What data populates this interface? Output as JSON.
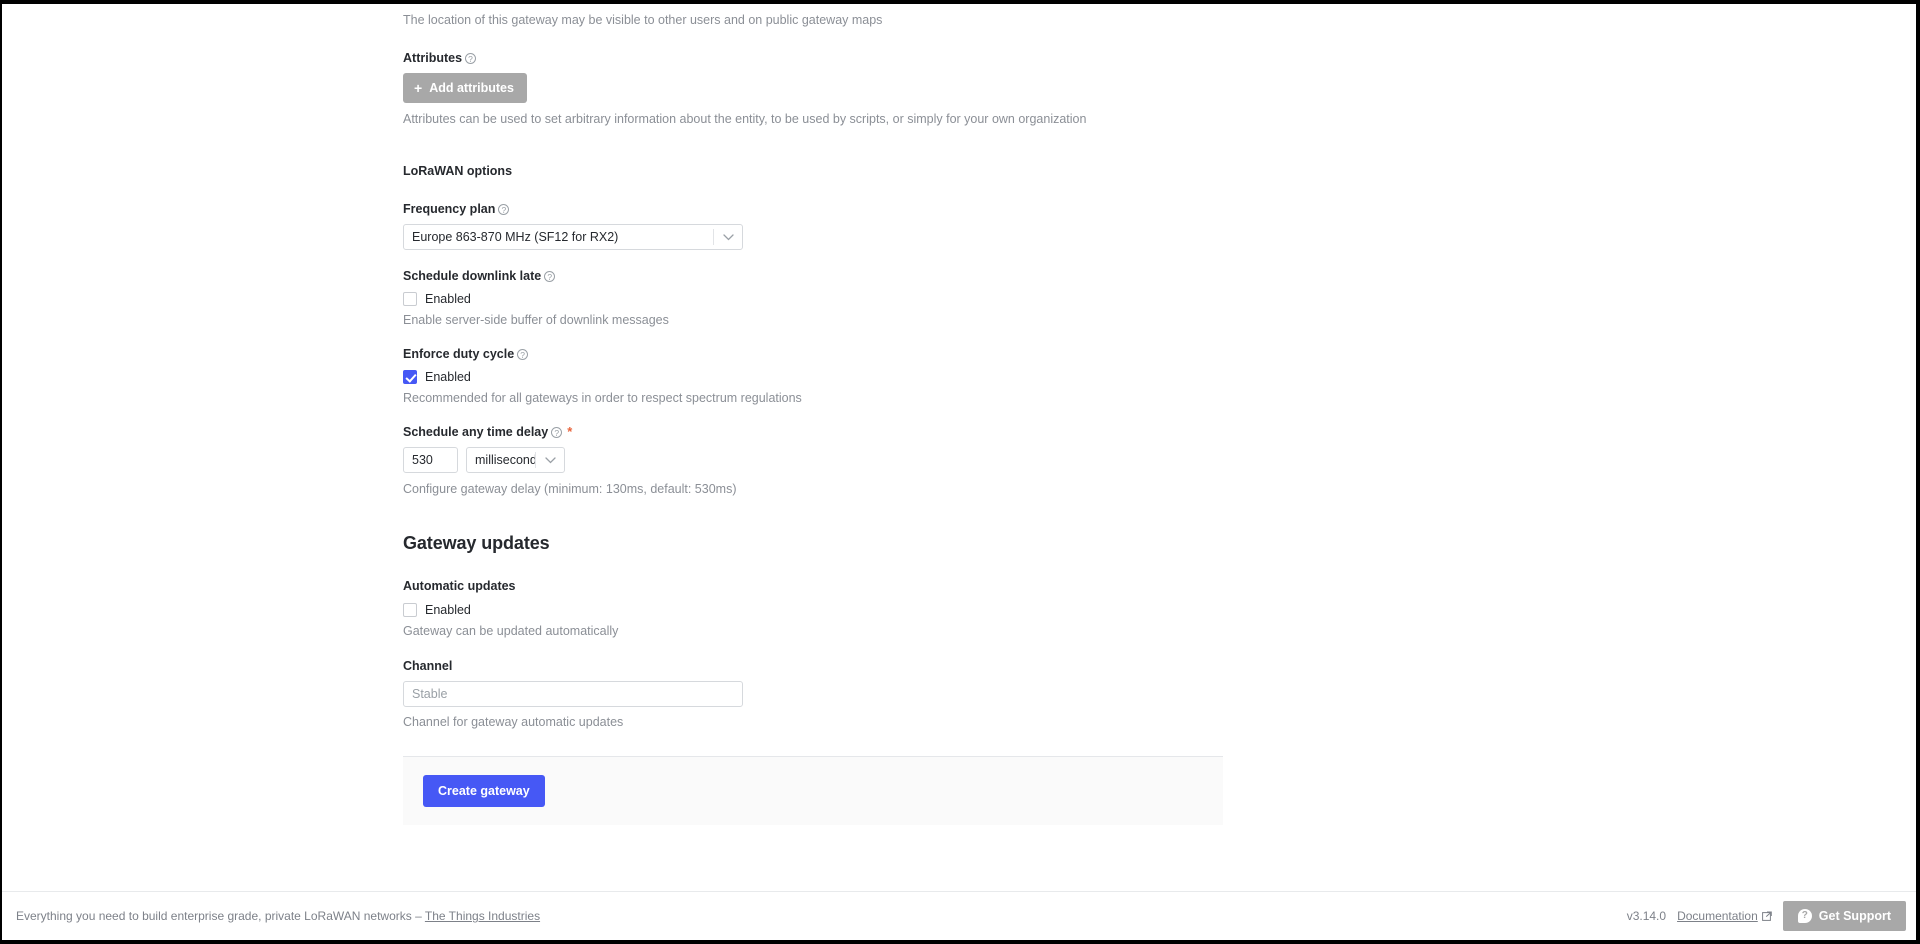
{
  "form": {
    "location_hint": "The location of this gateway may be visible to other users and on public gateway maps",
    "attributes": {
      "label": "Attributes",
      "button": "Add attributes",
      "plus": "+",
      "hint": "Attributes can be used to set arbitrary information about the entity, to be used by scripts, or simply for your own organization"
    },
    "lorawan_section": "LoRaWAN options",
    "frequency_plan": {
      "label": "Frequency plan",
      "value": "Europe 863-870 MHz (SF12 for RX2)"
    },
    "schedule_downlink_late": {
      "label": "Schedule downlink late",
      "checkbox_label": "Enabled",
      "checked": false,
      "hint": "Enable server-side buffer of downlink messages"
    },
    "enforce_duty_cycle": {
      "label": "Enforce duty cycle",
      "checkbox_label": "Enabled",
      "checked": true,
      "hint": "Recommended for all gateways in order to respect spectrum regulations"
    },
    "schedule_any_time_delay": {
      "label": "Schedule any time delay",
      "required_marker": "*",
      "value": "530",
      "unit": "milliseconds",
      "hint": "Configure gateway delay (minimum: 130ms, default: 530ms)"
    },
    "gateway_updates": {
      "heading": "Gateway updates",
      "automatic_updates": {
        "label": "Automatic updates",
        "checkbox_label": "Enabled",
        "checked": false,
        "hint": "Gateway can be updated automatically"
      },
      "channel": {
        "label": "Channel",
        "placeholder": "Stable",
        "value": "",
        "hint": "Channel for gateway automatic updates"
      }
    },
    "submit_button": "Create gateway"
  },
  "footer": {
    "tagline_prefix": "Everything you need to build enterprise grade, private LoRaWAN networks – ",
    "tagline_link": "The Things Industries",
    "version": "v3.14.0",
    "documentation": "Documentation",
    "support_button": "Get Support",
    "support_icon_glyph": "?"
  },
  "colors": {
    "accent_blue": "#4658f5",
    "button_grey": "#a8a8a8",
    "required_red": "#e8643c",
    "text_dark": "#26292e",
    "text_muted": "#8b8f96"
  }
}
